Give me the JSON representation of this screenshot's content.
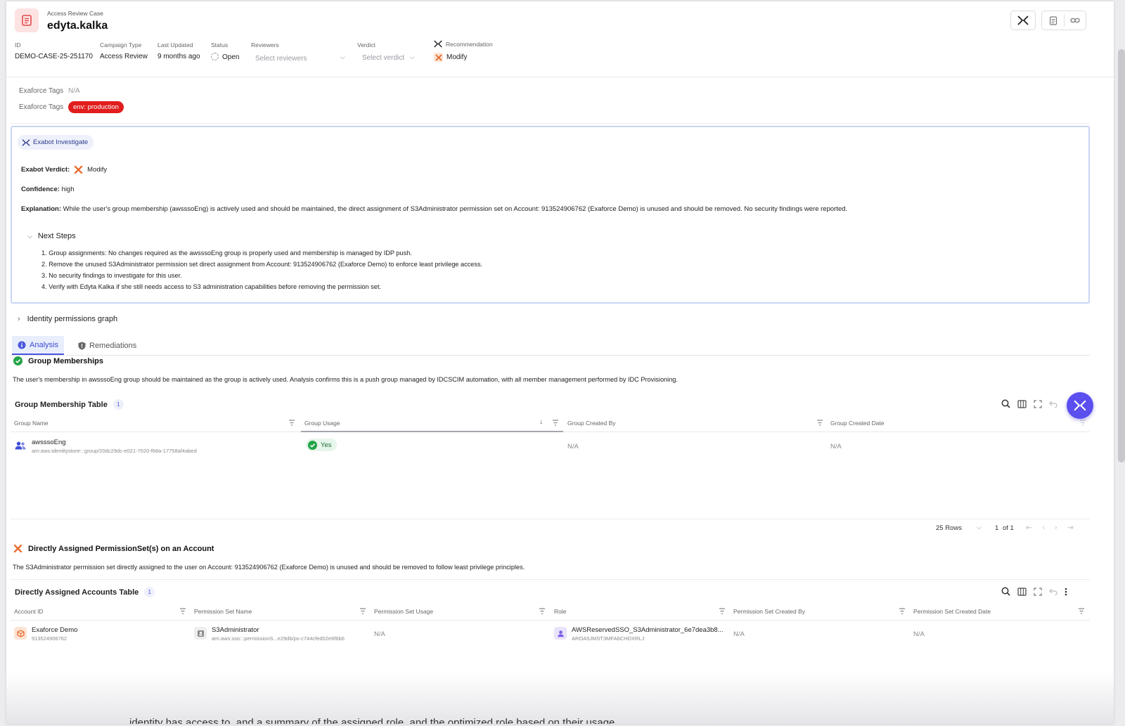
{
  "header": {
    "kicker": "Access Review Case",
    "title": "edyta.kalka",
    "meta": {
      "id_label": "ID",
      "id_value": "DEMO-CASE-25-251170",
      "campaign_label": "Campaign Type",
      "campaign_value": "Access Review",
      "updated_label": "Last Updated",
      "updated_value": "9 months ago",
      "status_label": "Status",
      "status_value": "Open",
      "reviewers_label": "Reviewers",
      "reviewers_placeholder": "Select reviewers",
      "verdict_label": "Verdict",
      "verdict_placeholder": "Select verdict",
      "recommendation_label": "Recommendation",
      "recommendation_value": "Modify"
    }
  },
  "tags": {
    "label1": "Exaforce Tags",
    "value1": "N/A",
    "label2": "Exaforce Tags",
    "pill": "env: production"
  },
  "exabot": {
    "chip": "Exabot Investigate",
    "verdict_label": "Exabot Verdict:",
    "verdict_value": "Modify",
    "confidence_label": "Confidence:",
    "confidence_value": "high",
    "explanation_label": "Explanation:",
    "explanation_value": "While the user's group membership (awsssoEng) is actively used and should be maintained, the direct assignment of S3Administrator permission set on Account: 913524906762 (Exaforce Demo) is unused and should be removed. No security findings were reported.",
    "next_steps_label": "Next Steps",
    "steps": [
      "1. Group assignments: No changes required as the awsssoEng group is properly used and membership is managed by IDP push.",
      "2. Remove the unused S3Administrator permission set direct assignment from Account: 913524906762 (Exaforce Demo) to enforce least privilege access.",
      "3. No security findings to investigate for this user.",
      "4. Verify with Edyta Kalka if she still needs access to S3 administration capabilities before removing the permission set."
    ]
  },
  "identity_graph": {
    "label": "Identity permissions graph"
  },
  "tabs": {
    "analysis": "Analysis",
    "remediations": "Remediations"
  },
  "group_section": {
    "title": "Group Memberships",
    "desc": "The user's membership in awsssoEng group should be maintained as the group is actively used. Analysis confirms this is a push group managed by IDCSCIM automation, with all member management performed by IDC Provisioning.",
    "table_title": "Group Membership Table",
    "count": "1",
    "columns": [
      "Group Name",
      "Group Usage",
      "Group Created By",
      "Group Created Date"
    ],
    "row": {
      "name": "awsssoEng",
      "arn": "arn:aws:identitystore:::group/20dc29dc-e021-7020-f68a-17758af4abed",
      "usage": "Yes",
      "created_by": "N/A",
      "created_date": "N/A"
    },
    "pager": {
      "rows": "25 Rows",
      "page": "1",
      "of": "of 1"
    }
  },
  "direct_section": {
    "title": "Directly Assigned PermissionSet(s) on an Account",
    "desc": "The S3Administrator permission set directly assigned to the user on Account: 913524906762 (Exaforce Demo) is unused and should be removed to follow least privilege principles.",
    "table_title": "Directly Assigned Accounts Table",
    "count": "1",
    "columns": [
      "Account ID",
      "Permission Set Name",
      "Permission Set Usage",
      "Role",
      "Permission Set Created By",
      "Permission Set Created Date"
    ],
    "row": {
      "account_name": "Exaforce Demo",
      "account_id": "913524906762",
      "ps_name": "S3Administrator",
      "ps_arn": "arn:aws:sso:::permissionS...e29db/ps-c744cfed02e6f6b6",
      "usage": "N/A",
      "role_name": "AWSReservedSSO_S3Administrator_6e7dea3b8...",
      "role_id": "AROA5JMST3MFA6CHDXRLJ",
      "created_by": "N/A",
      "created_date": "N/A"
    }
  },
  "bleed_text": "identity has access to, and a summary of the assigned role, and the optimized role based on their usage"
}
